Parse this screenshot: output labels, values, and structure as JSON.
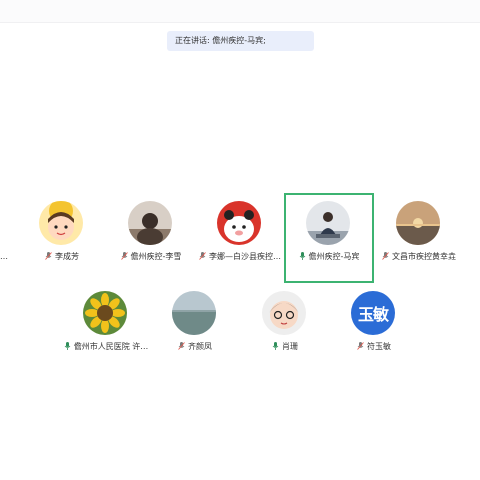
{
  "banner": {
    "text": "正在讲话: 儋州疾控-马宾;"
  },
  "edge_label": "…",
  "row1": [
    {
      "name": "李成芳",
      "mic": "muted",
      "avatar_icon": "cartoon-girl-avatar"
    },
    {
      "name": "儋州疾控-李雪",
      "mic": "muted",
      "avatar_icon": "photo-avatar"
    },
    {
      "name": "李娜—白沙县疾控…",
      "mic": "muted",
      "avatar_icon": "red-cartoon-avatar"
    },
    {
      "name": "儋州疾控-马宾",
      "mic": "active",
      "avatar_icon": "person-photo-avatar",
      "active": true
    },
    {
      "name": "文昌市疾控黄幸垚",
      "mic": "muted",
      "avatar_icon": "sunset-photo-avatar"
    }
  ],
  "row2": [
    {
      "name": "儋州市人民医院  许…",
      "mic": "active",
      "avatar_icon": "sunflower-avatar"
    },
    {
      "name": "齐颜凤",
      "mic": "muted",
      "avatar_icon": "sea-photo-avatar"
    },
    {
      "name": "肖珊",
      "mic": "active",
      "avatar_icon": "cartoon-avatar"
    },
    {
      "name": "符玉敏",
      "mic": "muted",
      "avatar_icon": "text-avatar",
      "avatar_text": "玉敏"
    }
  ],
  "colors": {
    "active_border": "#3cb371",
    "muted_mic": "#e05a4f",
    "text_avatar_bg": "#2b6cd6"
  }
}
